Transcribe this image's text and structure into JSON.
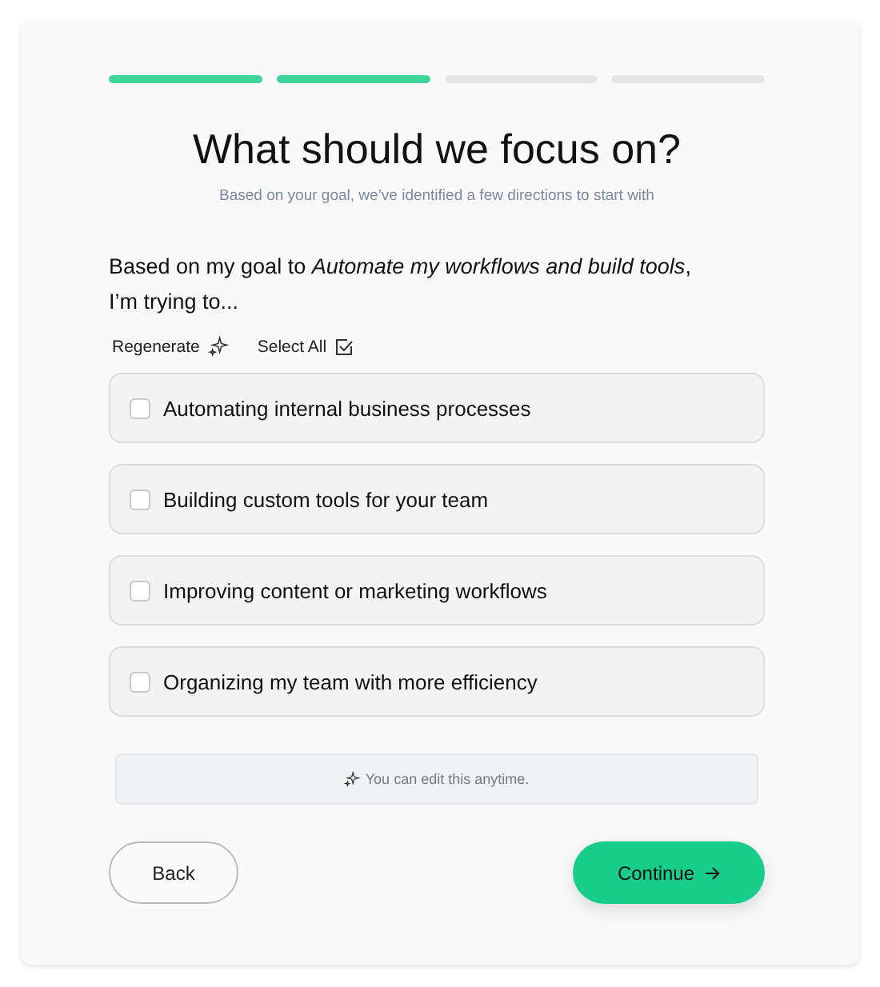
{
  "progress": [
    {
      "done": true
    },
    {
      "done": true
    },
    {
      "done": false
    },
    {
      "done": false
    }
  ],
  "title": "What should we focus on?",
  "subtitle": "Based on your goal, we’ve identified a few directions to start with",
  "prompt": "Based on my goal to *Automate my workflows and build tools*,\nI’m trying to...",
  "actions": [
    {
      "label": "Regenerate",
      "kind": "sparkle"
    },
    {
      "label": "Select All",
      "kind": "check"
    }
  ],
  "options": [
    {
      "label": "Automating internal business processes",
      "checked": false
    },
    {
      "label": "Building custom tools for your team",
      "checked": false
    },
    {
      "label": "Improving content or marketing workflows",
      "checked": false
    },
    {
      "label": "Organizing my team with more efficiency",
      "checked": false
    }
  ],
  "note": "You can edit this anytime.",
  "back": "Back",
  "continue": "Continue"
}
